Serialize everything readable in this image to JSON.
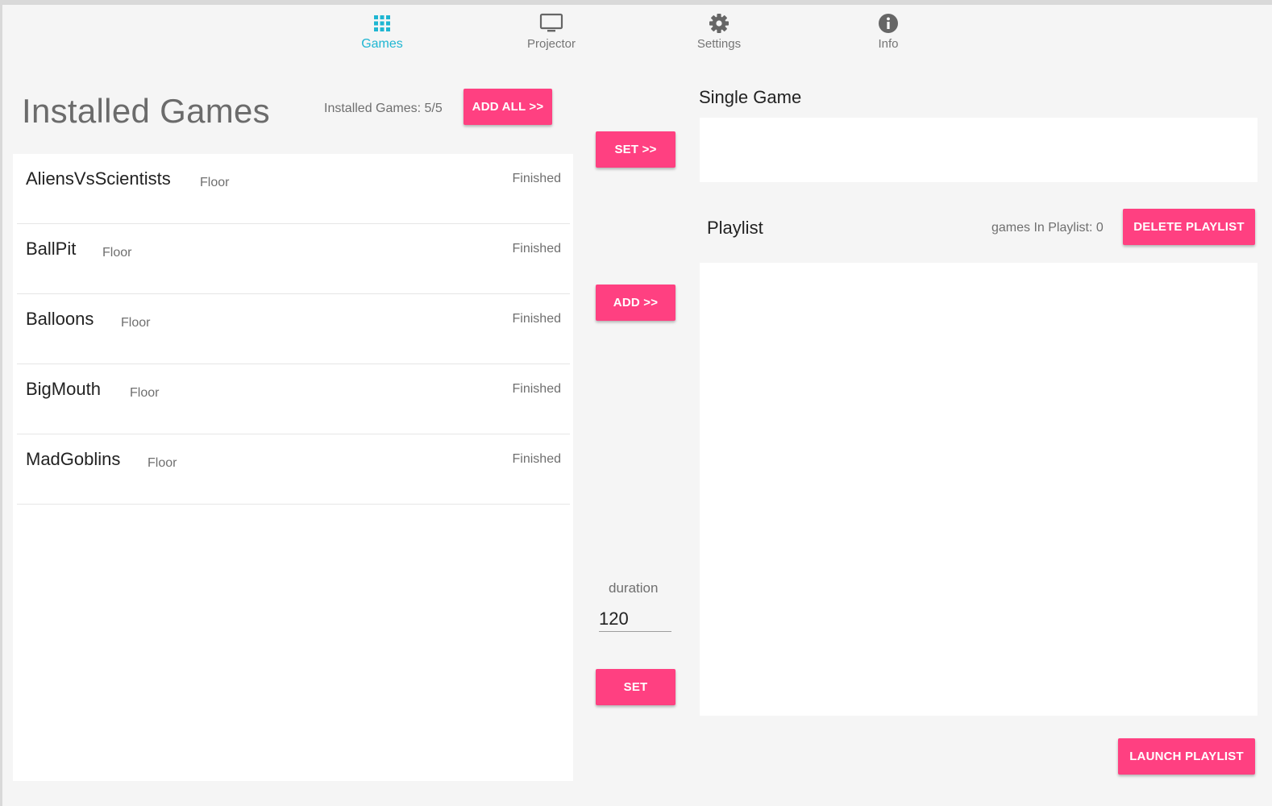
{
  "nav": {
    "tabs": [
      {
        "label": "Games",
        "icon": "grid-icon",
        "active": true
      },
      {
        "label": "Projector",
        "icon": "monitor-icon",
        "active": false
      },
      {
        "label": "Settings",
        "icon": "gear-icon",
        "active": false
      },
      {
        "label": "Info",
        "icon": "info-icon",
        "active": false
      }
    ]
  },
  "installed": {
    "title": "Installed Games",
    "count_text": "Installed Games: 5/5",
    "add_all_label": "ADD ALL >>",
    "games": [
      {
        "name": "AliensVsScientists",
        "type": "Floor",
        "status": "Finished"
      },
      {
        "name": "BallPit",
        "type": "Floor",
        "status": "Finished"
      },
      {
        "name": "Balloons",
        "type": "Floor",
        "status": "Finished"
      },
      {
        "name": "BigMouth",
        "type": "Floor",
        "status": "Finished"
      },
      {
        "name": "MadGoblins",
        "type": "Floor",
        "status": "Finished"
      }
    ]
  },
  "middle": {
    "set_single_label": "SET >>",
    "add_playlist_label": "ADD >>",
    "duration_label": "duration",
    "duration_value": "120",
    "set_duration_label": "SET"
  },
  "single_game": {
    "title": "Single Game"
  },
  "playlist": {
    "title": "Playlist",
    "count_text": "games In Playlist: 0",
    "delete_label": "DELETE PLAYLIST",
    "launch_label": "LAUNCH PLAYLIST"
  },
  "colors": {
    "accent": "#ff4081",
    "active_tab": "#1fb6d2",
    "background": "#f5f5f5",
    "panel": "#ffffff"
  }
}
